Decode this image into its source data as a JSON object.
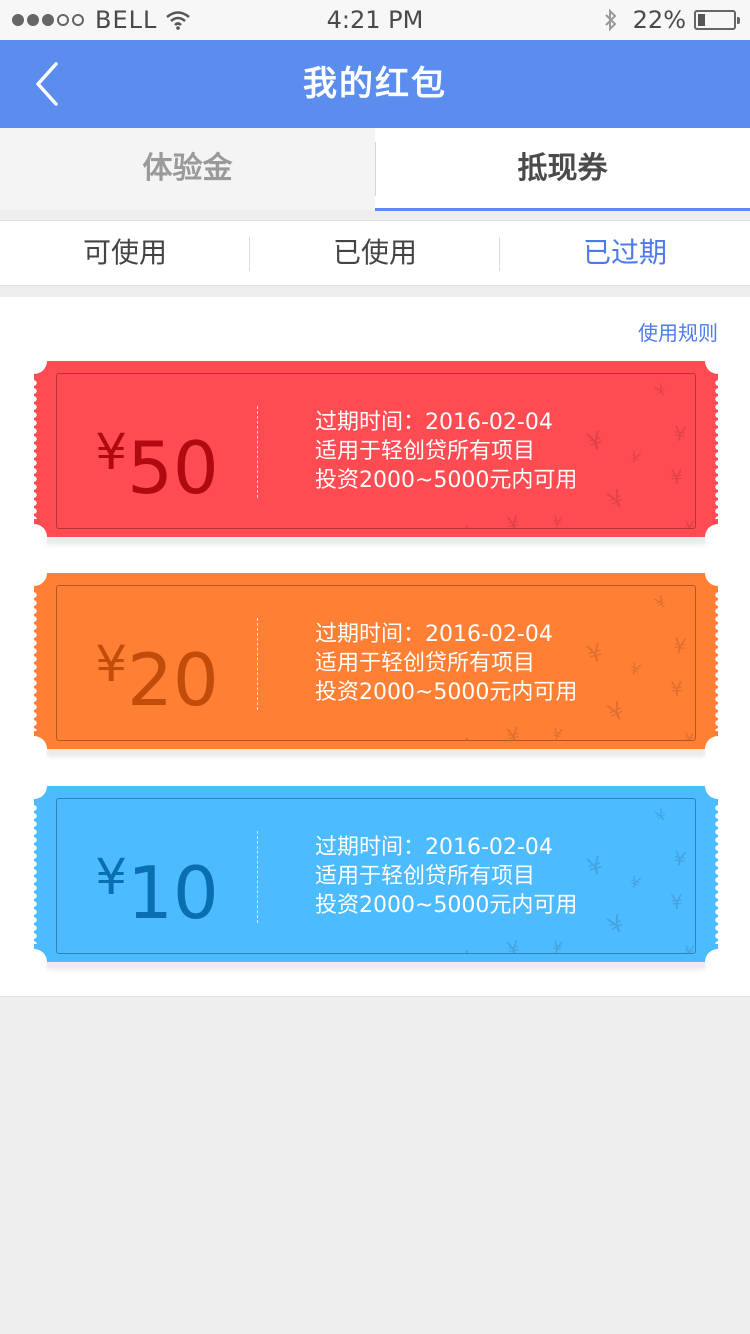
{
  "status_bar": {
    "carrier": "BELL",
    "time": "4:21 PM",
    "battery_percent_label": "22%",
    "battery_level": 0.22,
    "signal_bars_filled": 3,
    "signal_bars_total": 5
  },
  "nav": {
    "title": "我的红包",
    "back_icon": "chevron-left-icon"
  },
  "tabs": [
    {
      "label": "体验金",
      "active": false
    },
    {
      "label": "抵现券",
      "active": true
    }
  ],
  "sub_tabs": [
    {
      "label": "可使用",
      "active": false
    },
    {
      "label": "已使用",
      "active": false
    },
    {
      "label": "已过期",
      "active": true
    }
  ],
  "rules_link": "使用规则",
  "tickets": [
    {
      "currency": "¥",
      "amount": "50",
      "color": "#ff4c53",
      "expiry": "过期时间：2016-02-04",
      "scope": "适用于轻创贷所有项目",
      "condition": "投资2000~5000元内可用"
    },
    {
      "currency": "¥",
      "amount": "20",
      "color": "#ff7f35",
      "expiry": "过期时间：2016-02-04",
      "scope": "适用于轻创贷所有项目",
      "condition": "投资2000~5000元内可用"
    },
    {
      "currency": "¥",
      "amount": "10",
      "color": "#4dbbff",
      "expiry": "过期时间：2016-02-04",
      "scope": "适用于轻创贷所有项目",
      "condition": "投资2000~5000元内可用"
    }
  ],
  "colors": {
    "nav_bg": "#5b8def",
    "accent": "#4f7bea"
  }
}
